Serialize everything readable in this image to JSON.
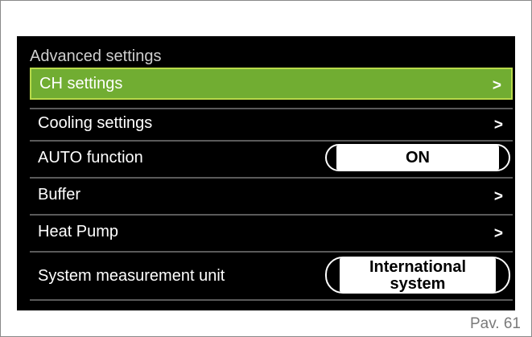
{
  "section_title": "Advanced settings",
  "items": [
    {
      "label": "CH settings",
      "control": ">"
    },
    {
      "label": "Cooling settings",
      "control": ">"
    },
    {
      "label": "AUTO function",
      "control": "ON"
    },
    {
      "label": "Buffer",
      "control": ">"
    },
    {
      "label": "Heat Pump",
      "control": ">"
    },
    {
      "label": "System measurement unit",
      "control_line1": "International",
      "control_line2": "system"
    }
  ],
  "footer": "Pav. 61",
  "colors": {
    "selected_bg": "#71ad32",
    "selected_border": "#b8d94a",
    "screen_bg": "#000000"
  }
}
